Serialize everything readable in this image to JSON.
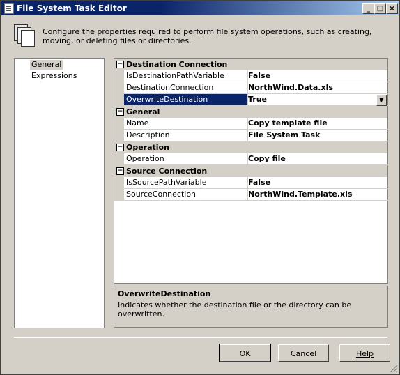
{
  "window": {
    "title": "File System Task Editor",
    "controls": {
      "minimize": "_",
      "maximize": "□",
      "close": "×"
    }
  },
  "header": {
    "description": "Configure the properties required to perform file system operations, such as creating, moving, or deleting files or directories."
  },
  "nav": {
    "items": [
      {
        "label": "General",
        "selected": true
      },
      {
        "label": "Expressions",
        "selected": false
      }
    ]
  },
  "grid": {
    "categories": [
      {
        "name": "Destination Connection",
        "toggle": "⊟",
        "properties": [
          {
            "name": "IsDestinationPathVariable",
            "value": "False"
          },
          {
            "name": "DestinationConnection",
            "value": "NorthWind.Data.xls"
          },
          {
            "name": "OverwriteDestination",
            "value": "True"
          }
        ]
      },
      {
        "name": "General",
        "toggle": "⊟",
        "properties": [
          {
            "name": "Name",
            "value": "Copy template file"
          },
          {
            "name": "Description",
            "value": "File System Task"
          }
        ]
      },
      {
        "name": "Operation",
        "toggle": "⊟",
        "properties": [
          {
            "name": "Operation",
            "value": "Copy file"
          }
        ]
      },
      {
        "name": "Source Connection",
        "toggle": "⊟",
        "properties": [
          {
            "name": "IsSourcePathVariable",
            "value": "False"
          },
          {
            "name": "SourceConnection",
            "value": "NorthWind.Template.xls"
          }
        ]
      }
    ]
  },
  "description_panel": {
    "title": "OverwriteDestination",
    "text": "Indicates whether the destination file or the directory can be overwritten."
  },
  "buttons": {
    "ok": "OK",
    "cancel": "Cancel",
    "help": "Help"
  },
  "colors": {
    "selection": "#0a246a",
    "face": "#d4d0c8"
  }
}
